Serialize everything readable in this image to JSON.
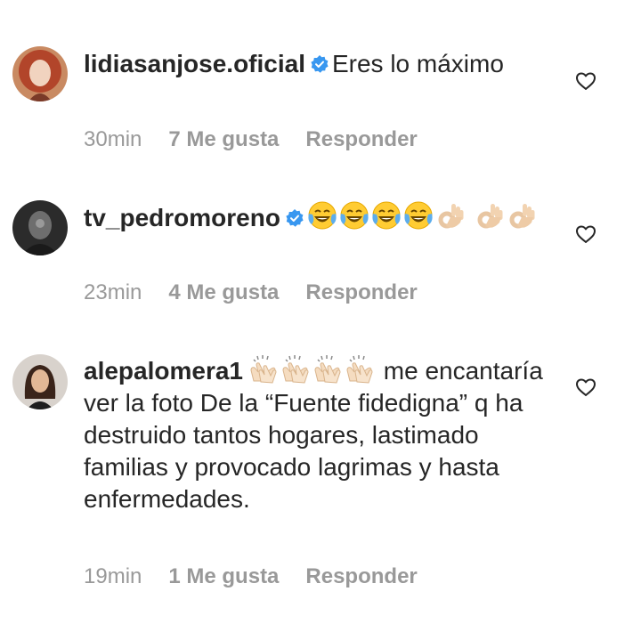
{
  "comments": [
    {
      "username": "lidiasanjose.oficial",
      "verified": true,
      "text": "Eres lo máximo",
      "time": "30min",
      "likes": "7 Me gusta",
      "reply": "Responder"
    },
    {
      "username": "tv_pedromoreno",
      "verified": true,
      "emojis": [
        "face-with-tears-of-joy",
        "face-with-tears-of-joy",
        "face-with-tears-of-joy",
        "face-with-tears-of-joy",
        "ok-hand",
        "ok-hand",
        "ok-hand"
      ],
      "time": "23min",
      "likes": "4 Me gusta",
      "reply": "Responder"
    },
    {
      "username": "alepalomera1",
      "verified": false,
      "emojis": [
        "clapping-hands",
        "clapping-hands",
        "clapping-hands",
        "clapping-hands"
      ],
      "text": "me encantaría ver la foto De la “Fuente fidedigna” q ha destruido tantos hogares, lastimado familias y provocado lagrimas y hasta enfermedades.",
      "time": "19min",
      "likes": "1 Me gusta",
      "reply": "Responder"
    }
  ],
  "colors": {
    "text": "#262626",
    "meta": "#999999",
    "verified": "#3897f0"
  }
}
